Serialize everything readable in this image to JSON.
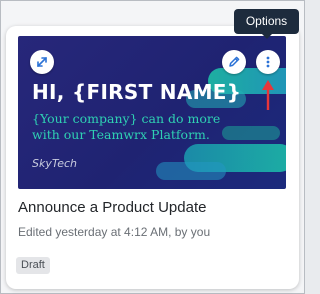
{
  "tooltip": {
    "text": "Options"
  },
  "card": {
    "thumbnail": {
      "headline": "HI, {FIRST NAME}",
      "subline": "{Your company} can do more with our Teamwrx Platform.",
      "logo_text": "SkyTech"
    },
    "title": "Announce a Product Update",
    "subtitle": "Edited yesterday at 4:12 AM, by you",
    "status_badge": "Draft"
  },
  "icons": {
    "expand": "expand-icon",
    "edit": "pencil-icon",
    "options": "more-vertical-icon",
    "annotation": "red-arrow-up-icon"
  },
  "colors": {
    "thumbnail_bg": "#1f2372",
    "accent_teal": "#2fd1b3",
    "icon_blue": "#2b72d6",
    "tooltip_bg": "#1d2b3d",
    "annotation_red": "#e8363a"
  }
}
